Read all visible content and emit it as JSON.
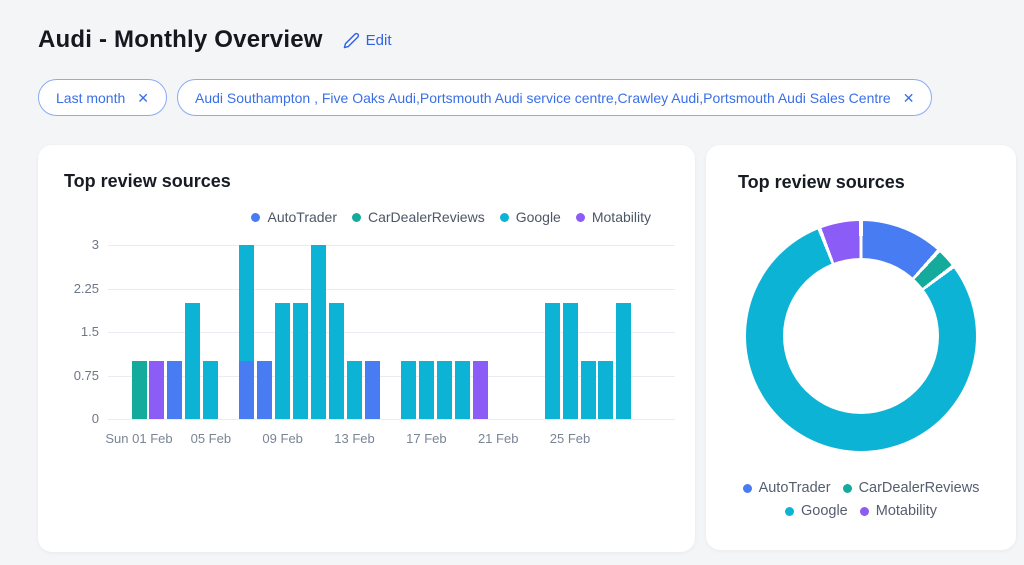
{
  "header": {
    "title": "Audi - Monthly Overview",
    "edit_label": "Edit"
  },
  "icons": {
    "close_glyph": "✕"
  },
  "filters": [
    {
      "label": "Last month"
    },
    {
      "label": "Audi Southampton , Five Oaks Audi,Portsmouth Audi service centre,Crawley Audi,Portsmouth Audi Sales Centre"
    }
  ],
  "colors": {
    "AutoTrader": "#477cf2",
    "CarDealerReviews": "#15ab9c",
    "Google": "#0db3d5",
    "Motability": "#8b5cf6",
    "accent_blue": "#2f62e6",
    "grid": "#e9ecf1",
    "axis_text": "#6e7787"
  },
  "bar_card": {
    "title": "Top review sources",
    "legend": [
      "AutoTrader",
      "CarDealerReviews",
      "Google",
      "Motability"
    ]
  },
  "donut_card": {
    "title": "Top review sources",
    "legend_rows": [
      [
        "AutoTrader",
        "CarDealerReviews"
      ],
      [
        "Google",
        "Motability"
      ]
    ]
  },
  "chart_data": [
    {
      "type": "bar",
      "title": "Top review sources",
      "stacked": true,
      "series_names": [
        "AutoTrader",
        "CarDealerReviews",
        "Google",
        "Motability"
      ],
      "ylim": [
        0,
        3
      ],
      "y_ticks": [
        0,
        0.75,
        1.5,
        2.25,
        3
      ],
      "grid": true,
      "legend_position": "top-right",
      "x_ticks": [
        {
          "i": 0,
          "label": "Sun 01 Feb"
        },
        {
          "i": 4,
          "label": "05 Feb"
        },
        {
          "i": 8,
          "label": "09 Feb"
        },
        {
          "i": 12,
          "label": "13 Feb"
        },
        {
          "i": 16,
          "label": "17 Feb"
        },
        {
          "i": 20,
          "label": "21 Feb"
        },
        {
          "i": 24,
          "label": "25 Feb"
        }
      ],
      "bars": [
        {
          "date": "01 Feb",
          "segments": [
            {
              "source": "CarDealerReviews",
              "value": 1
            }
          ]
        },
        {
          "date": "02 Feb",
          "segments": [
            {
              "source": "Motability",
              "value": 1
            }
          ]
        },
        {
          "date": "03 Feb",
          "segments": [
            {
              "source": "AutoTrader",
              "value": 1
            }
          ]
        },
        {
          "date": "04 Feb",
          "segments": [
            {
              "source": "Google",
              "value": 2
            }
          ]
        },
        {
          "date": "05 Feb",
          "segments": [
            {
              "source": "Google",
              "value": 1
            }
          ]
        },
        {
          "date": "06 Feb",
          "segments": []
        },
        {
          "date": "07 Feb",
          "segments": [
            {
              "source": "AutoTrader",
              "value": 1
            },
            {
              "source": "Google",
              "value": 2
            }
          ]
        },
        {
          "date": "08 Feb",
          "segments": [
            {
              "source": "AutoTrader",
              "value": 1
            }
          ]
        },
        {
          "date": "09 Feb",
          "segments": [
            {
              "source": "Google",
              "value": 2
            }
          ]
        },
        {
          "date": "10 Feb",
          "segments": [
            {
              "source": "Google",
              "value": 2
            }
          ]
        },
        {
          "date": "11 Feb",
          "segments": [
            {
              "source": "Google",
              "value": 3
            }
          ]
        },
        {
          "date": "12 Feb",
          "segments": [
            {
              "source": "Google",
              "value": 2
            }
          ]
        },
        {
          "date": "13 Feb",
          "segments": [
            {
              "source": "Google",
              "value": 1
            }
          ]
        },
        {
          "date": "14 Feb",
          "segments": [
            {
              "source": "AutoTrader",
              "value": 1
            }
          ]
        },
        {
          "date": "15 Feb",
          "segments": []
        },
        {
          "date": "16 Feb",
          "segments": [
            {
              "source": "Google",
              "value": 1
            }
          ]
        },
        {
          "date": "17 Feb",
          "segments": [
            {
              "source": "Google",
              "value": 1
            }
          ]
        },
        {
          "date": "18 Feb",
          "segments": [
            {
              "source": "Google",
              "value": 1
            }
          ]
        },
        {
          "date": "19 Feb",
          "segments": [
            {
              "source": "Google",
              "value": 1
            }
          ]
        },
        {
          "date": "20 Feb",
          "segments": [
            {
              "source": "Motability",
              "value": 1
            }
          ]
        },
        {
          "date": "21 Feb",
          "segments": []
        },
        {
          "date": "22 Feb",
          "segments": []
        },
        {
          "date": "23 Feb",
          "segments": []
        },
        {
          "date": "24 Feb",
          "segments": [
            {
              "source": "Google",
              "value": 2
            }
          ]
        },
        {
          "date": "25 Feb",
          "segments": [
            {
              "source": "Google",
              "value": 2
            }
          ]
        },
        {
          "date": "26 Feb",
          "segments": [
            {
              "source": "Google",
              "value": 1
            }
          ]
        },
        {
          "date": "27 Feb",
          "segments": [
            {
              "source": "Google",
              "value": 1
            }
          ]
        },
        {
          "date": "28 Feb",
          "segments": [
            {
              "source": "Google",
              "value": 2
            }
          ]
        }
      ]
    },
    {
      "type": "pie",
      "title": "Top review sources",
      "donut": true,
      "legend_position": "bottom-center",
      "slices": [
        {
          "label": "AutoTrader",
          "value": 4
        },
        {
          "label": "CarDealerReviews",
          "value": 1
        },
        {
          "label": "Google",
          "value": 27
        },
        {
          "label": "Motability",
          "value": 2
        }
      ]
    }
  ]
}
